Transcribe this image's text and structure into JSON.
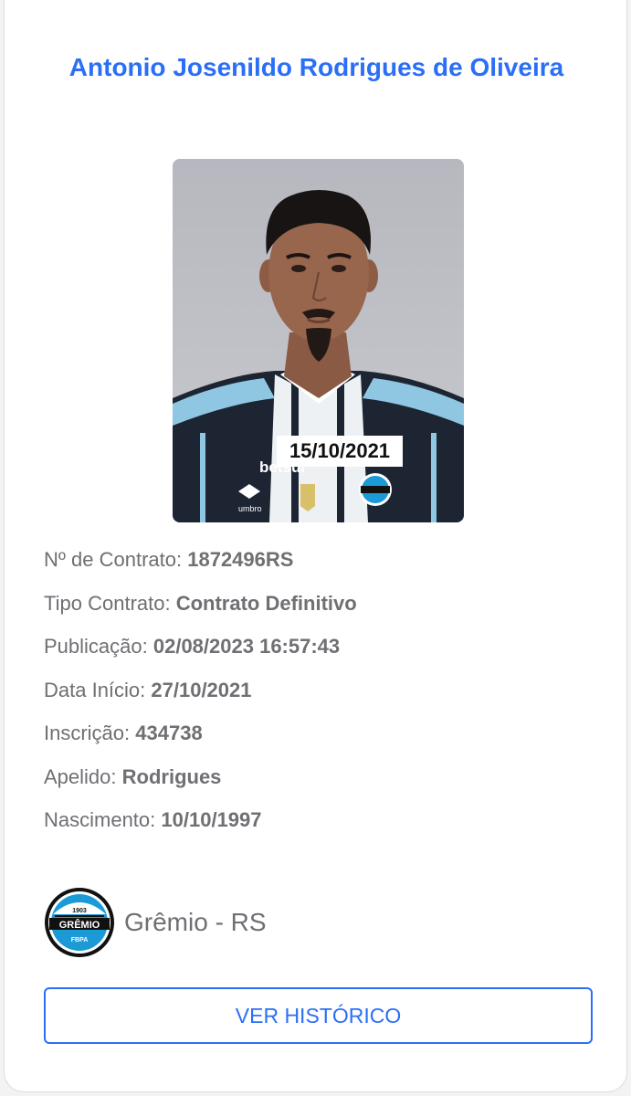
{
  "player": {
    "name": "Antonio Josenildo Rodrigues de Oliveira",
    "photo_date": "15/10/2021",
    "sponsor_text": "betsul",
    "kit_brand_text": "umbro"
  },
  "details": [
    {
      "label": "Nº de Contrato: ",
      "value": "1872496RS"
    },
    {
      "label": "Tipo Contrato: ",
      "value": "Contrato Definitivo"
    },
    {
      "label": "Publicação: ",
      "value": "02/08/2023 16:57:43"
    },
    {
      "label": "Data Início: ",
      "value": "27/10/2021"
    },
    {
      "label": "Inscrição: ",
      "value": "434738"
    },
    {
      "label": "Apelido: ",
      "value": "Rodrigues"
    },
    {
      "label": "Nascimento: ",
      "value": "10/10/1997"
    }
  ],
  "club": {
    "name": "Grêmio - RS",
    "logo_year": "1903",
    "logo_text": "GRÊMIO",
    "logo_sub": "FBPA"
  },
  "actions": {
    "history_label": "VER HISTÓRICO"
  },
  "colors": {
    "accent": "#2b6ff6",
    "text_muted": "#6f6f74",
    "club_blue": "#1c9ad6",
    "club_black": "#111111"
  }
}
